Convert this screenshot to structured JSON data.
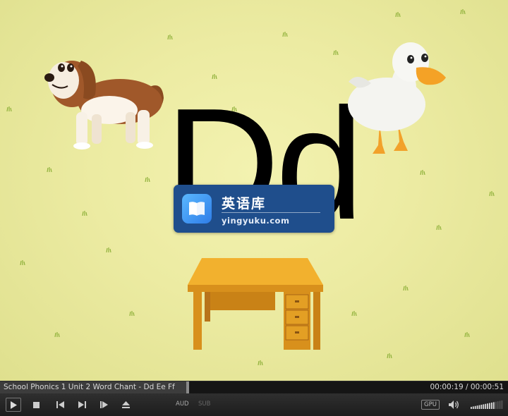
{
  "video": {
    "letters": "Dd",
    "watermark": {
      "title": "英语库",
      "url": "yingyuku.com"
    }
  },
  "player": {
    "media_title": "School Phonics 1 Unit 2 Word Chant - Dd Ee Ff",
    "time": "00:00:19 / 00:00:51",
    "progress": 0.37,
    "audio_label": "AUD",
    "subtitle_label": "SUB",
    "gpu_label": "GPU",
    "volume_level": 0.75
  },
  "colors": {
    "background": "#ecebA2",
    "watermark_bg": "#1f4e8c",
    "desk": "#e8a628",
    "dog_brown": "#a0582a",
    "duck_beak": "#f4a226"
  },
  "icons": [
    "play-icon",
    "stop-icon",
    "previous-icon",
    "next-icon",
    "frame-step-icon",
    "eject-icon",
    "volume-icon",
    "book-icon"
  ]
}
